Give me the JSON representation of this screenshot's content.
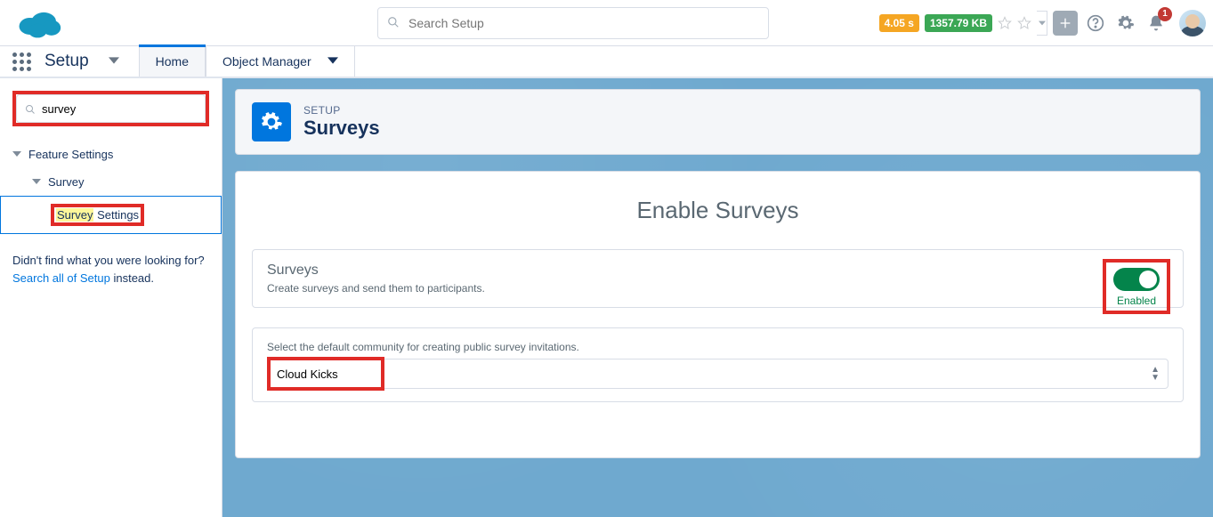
{
  "header": {
    "search_placeholder": "Search Setup",
    "timer_badge": "4.05 s",
    "size_badge": "1357.79 KB",
    "notification_count": "1"
  },
  "subnav": {
    "app_label": "Setup",
    "tabs": [
      {
        "label": "Home",
        "active": true
      },
      {
        "label": "Object Manager",
        "active": false,
        "has_chevron": true
      }
    ]
  },
  "sidebar": {
    "quickfind_value": "survey",
    "tree": {
      "lvl1_label": "Feature Settings",
      "lvl2_label": "Survey",
      "lvl3_highlight": "Survey",
      "lvl3_rest": " Settings"
    },
    "nofind_prefix": "Didn't find what you were looking for? ",
    "nofind_link": "Search all of Setup",
    "nofind_suffix": " instead."
  },
  "page_header": {
    "eyebrow": "SETUP",
    "title": "Surveys"
  },
  "card": {
    "heading": "Enable Surveys",
    "section1_title": "Surveys",
    "section1_desc": "Create surveys and send them to participants.",
    "toggle_label": "Enabled",
    "section2_label": "Select the default community for creating public survey invitations.",
    "community_selected": "Cloud Kicks"
  }
}
